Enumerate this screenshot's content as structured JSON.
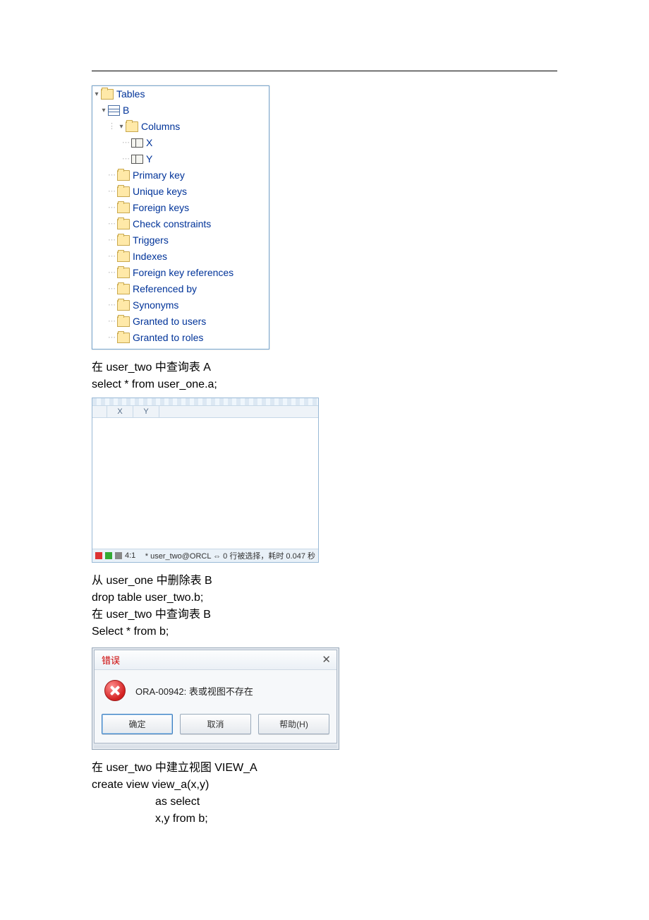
{
  "tree": {
    "root": "Tables",
    "table": "B",
    "columns_label": "Columns",
    "columns": [
      "X",
      "Y"
    ],
    "items": [
      "Primary key",
      "Unique keys",
      "Foreign keys",
      "Check constraints",
      "Triggers",
      "Indexes",
      "Foreign key references",
      "Referenced by",
      "Synonyms",
      "Granted to users",
      "Granted to roles"
    ]
  },
  "text": {
    "line1": "在 user_two 中查询表 A",
    "line2": "select * from user_one.a;",
    "line3": "从 user_one 中删除表 B",
    "line4": "drop table user_two.b;",
    "line5": "在 user_two 中查询表 B",
    "line6": "Select * from b;",
    "line7": "在 user_two 中建立视图 VIEW_A",
    "line8": "create view view_a(x,y)",
    "line9": "as select",
    "line10": "x,y from b;"
  },
  "grid": {
    "header_x": "X",
    "header_y": "Y",
    "status_pos": "4:1",
    "status_text": "* user_two@ORCL ⇔ 0 行被选择，耗时 0.047 秒"
  },
  "dialog": {
    "title": "错误",
    "message": "ORA-00942: 表或视图不存在",
    "ok": "确定",
    "cancel": "取消",
    "help": "帮助(H)"
  }
}
